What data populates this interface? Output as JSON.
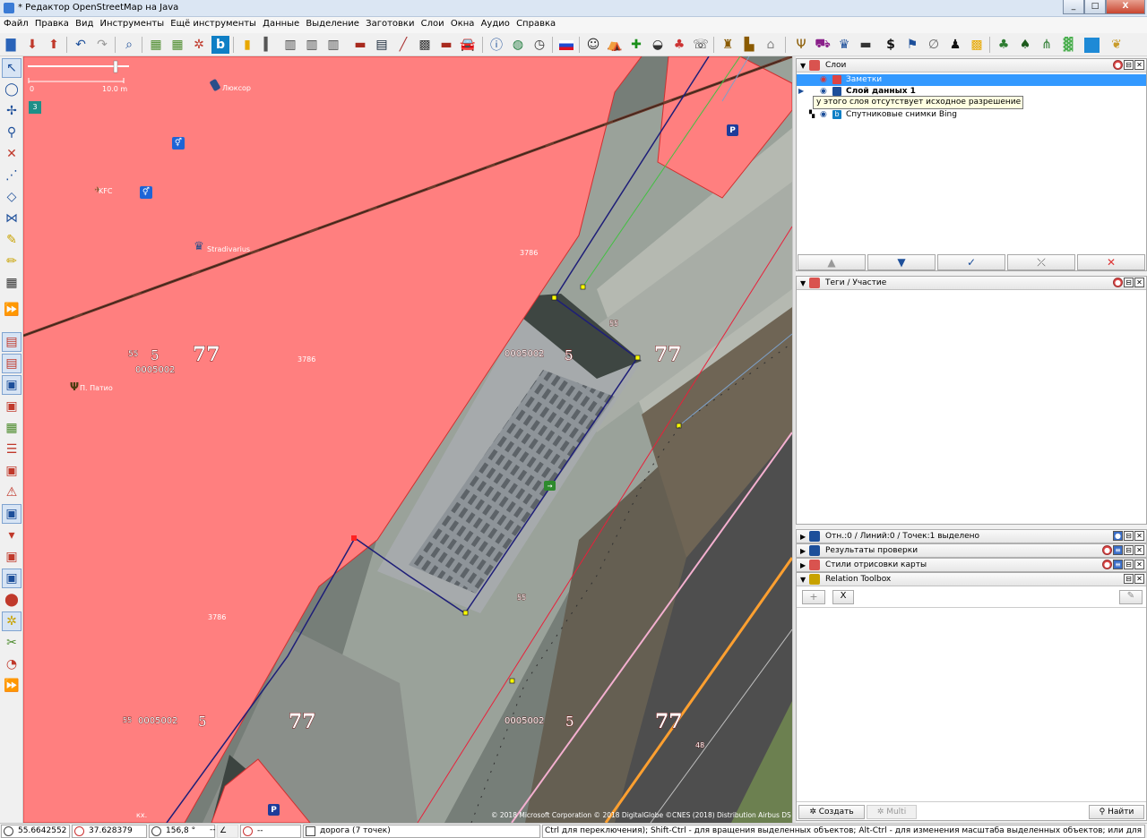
{
  "window": {
    "title": "* Редактор OpenStreetMap на Java",
    "min": "_",
    "max": "□",
    "close": "X"
  },
  "menu": [
    "Файл",
    "Правка",
    "Вид",
    "Инструменты",
    "Ещё инструменты",
    "Данные",
    "Выделение",
    "Заготовки",
    "Слои",
    "Окна",
    "Аудио",
    "Справка"
  ],
  "map": {
    "scale_left": "0",
    "scale_right": "10.0 m",
    "zoom_badge": "3",
    "labels": {
      "luxor": "Люксор",
      "kfc": "KFC",
      "stradivarius": "Stradivarius",
      "patio": "П. Патио",
      "r3786a": "3786",
      "r3786b": "3786",
      "r3786c": "3786",
      "n55a": "55",
      "n5a": "5",
      "n77a": "77",
      "code_a": "0005002",
      "code_b": "0005002",
      "n5b": "5",
      "n77b": "77",
      "n55b": "55",
      "n55c": "55",
      "code_c": "0005002",
      "n5c": "5",
      "n77c": "77",
      "code_d": "0005002",
      "n5d": "5",
      "n77d": "77",
      "n55d": "55",
      "n48": "48",
      "kh": "кх."
    },
    "attribution": "© 2018 Microsoft Corporation © 2018 DigitalGlobe ©CNES (2018) Distribution Airbus DS",
    "parking": "P"
  },
  "layers_panel": {
    "title": "Слои",
    "rows": [
      {
        "name": "Заметки",
        "selected": true
      },
      {
        "name": "Слой данных 1",
        "bold": true
      },
      {
        "name": "Спутниковые снимки Bing"
      }
    ],
    "tooltip": "у этого слоя отсутствует исходное разрешение",
    "buttons": [
      "▲",
      "▼",
      "✓",
      "⤫",
      "✕"
    ]
  },
  "tags_panel": {
    "title": "Теги / Участие"
  },
  "collapsed_panels": [
    {
      "title": "Отн.:0 / Линий:0 / Точек:1 выделено"
    },
    {
      "title": "Результаты проверки"
    },
    {
      "title": "Стили отрисовки карты"
    }
  ],
  "relation_toolbox": {
    "title": "Relation Toolbox",
    "add": "+",
    "x": "X",
    "edit": "✎",
    "create": "Создать",
    "multi": "Multi",
    "find": "Найти"
  },
  "status": {
    "lat": "55.6642552",
    "lon": "37.628379",
    "heading": "156,8 °",
    "angle": "--",
    "length": "--",
    "way": "дорога (7 точек)",
    "help": "Ctrl для переключения); Shift-Ctrl - для вращения выделенных объектов; Alt-Ctrl - для изменения масштаба выделенных объектов; или для изменения выделения"
  },
  "colors": {
    "landuse": "#ff7f7f",
    "selection": "#1e1e78",
    "blue_panel": "#3399ff"
  }
}
